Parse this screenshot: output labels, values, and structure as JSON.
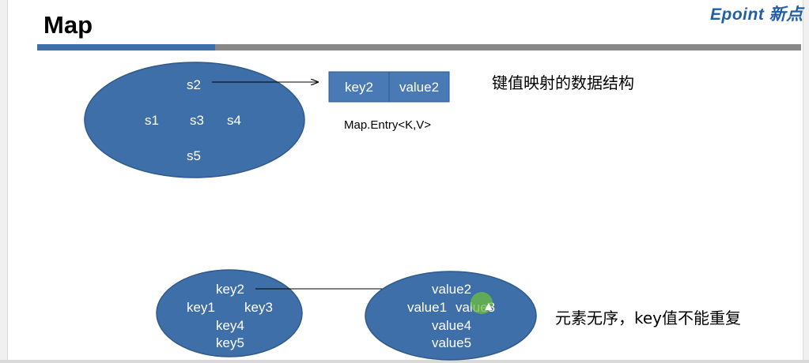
{
  "header": {
    "title": "Map",
    "logo": "Epoint 新点"
  },
  "top_diagram": {
    "set_items": [
      "s1",
      "s2",
      "s3",
      "s4",
      "s5"
    ],
    "entry": {
      "key": "key2",
      "value": "value2"
    },
    "entry_caption": "Map.Entry<K,V>",
    "description": "键值映射的数据结构"
  },
  "bottom_diagram": {
    "keys": [
      "key1",
      "key2",
      "key3",
      "key4",
      "key5"
    ],
    "values": [
      "value1",
      "value2",
      "value3",
      "value4",
      "value5"
    ],
    "description": "元素无序，key值不能重复"
  },
  "colors": {
    "ellipse_fill": "#3f6fa8",
    "entry_fill": "#4a7ab5",
    "bar_blue": "#3f6fa8",
    "bar_gray": "#888888",
    "logo": "#1f5fa8"
  }
}
